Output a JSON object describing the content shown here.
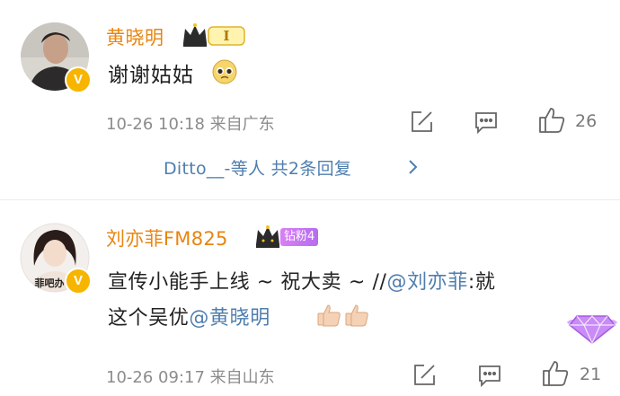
{
  "comments": [
    {
      "author": "黄晓明",
      "crown_level": "I",
      "text": "谢谢姑姑",
      "timestamp": "10-26 10:18",
      "location": "来自广东",
      "likes": "26",
      "verified": "V",
      "reply_summary": "Ditto__-等人 共2条回复"
    },
    {
      "author": "刘亦菲FM825",
      "fan_badge": "钻粉4",
      "text_line1_prefix": "宣传小能手上线 ~ 祝大卖 ~ //",
      "mention1": "@刘亦菲",
      "text_line1_suffix": ":就",
      "text_line2_prefix": "这个吴优",
      "mention2": "@黄晓明",
      "avatar_text": "菲吧办",
      "timestamp": "10-26 09:17",
      "location": "来自山东",
      "likes": "21",
      "verified": "V"
    }
  ],
  "icons": {
    "share": "share-icon",
    "comment": "comment-icon",
    "like": "like-icon",
    "crown": "crown-icon",
    "emoji": "pleading-face-emoji",
    "thumbs": "thumbs-up-emoji",
    "gem": "diamond-gem-icon",
    "chevron": "chevron-right-icon"
  },
  "colors": {
    "author_name": "#e8850f",
    "link": "#4f7eae",
    "meta_text": "#8c8c8c",
    "verified_badge": "#f7b500",
    "fan_badge": "#c777f2"
  }
}
